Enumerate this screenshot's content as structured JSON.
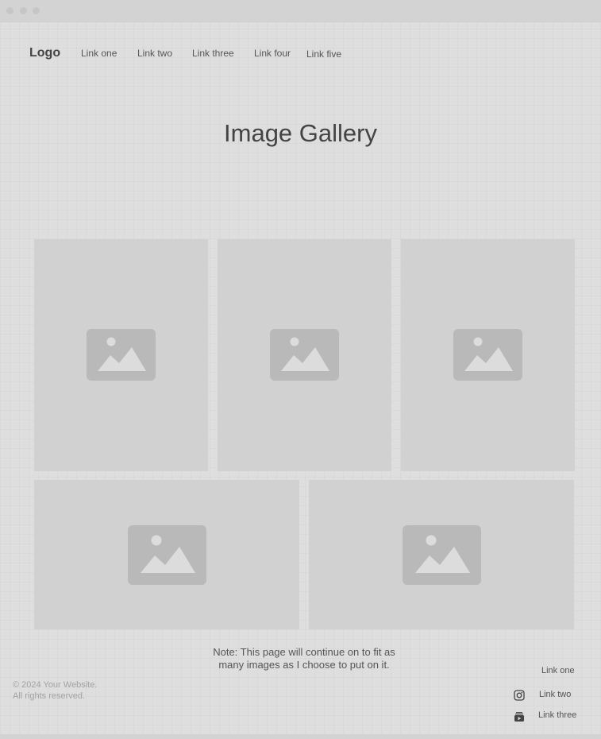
{
  "nav": {
    "logo": "Logo",
    "links": [
      "Link one",
      "Link two",
      "Link three",
      "Link four",
      "Link five"
    ]
  },
  "page": {
    "title": "Image Gallery"
  },
  "gallery": {
    "images": [
      {
        "icon": "image-placeholder-icon"
      },
      {
        "icon": "image-placeholder-icon"
      },
      {
        "icon": "image-placeholder-icon"
      },
      {
        "icon": "image-placeholder-icon"
      },
      {
        "icon": "image-placeholder-icon"
      }
    ]
  },
  "note": {
    "line1": "Note: This page will continue on to fit as",
    "line2": "many images as I choose to put on it."
  },
  "footer": {
    "copyright_line1": "© 2024 Your Website.",
    "copyright_line2": "All rights reserved.",
    "links": [
      {
        "label": "Link one",
        "icon": ""
      },
      {
        "label": "Link two",
        "icon": "instagram-icon"
      },
      {
        "label": "Link three",
        "icon": "youtube-icon"
      }
    ]
  },
  "colors": {
    "background": "#dedede",
    "card": "#d1d1d1",
    "placeholder": "#b9b9b9",
    "text": "#444444"
  }
}
